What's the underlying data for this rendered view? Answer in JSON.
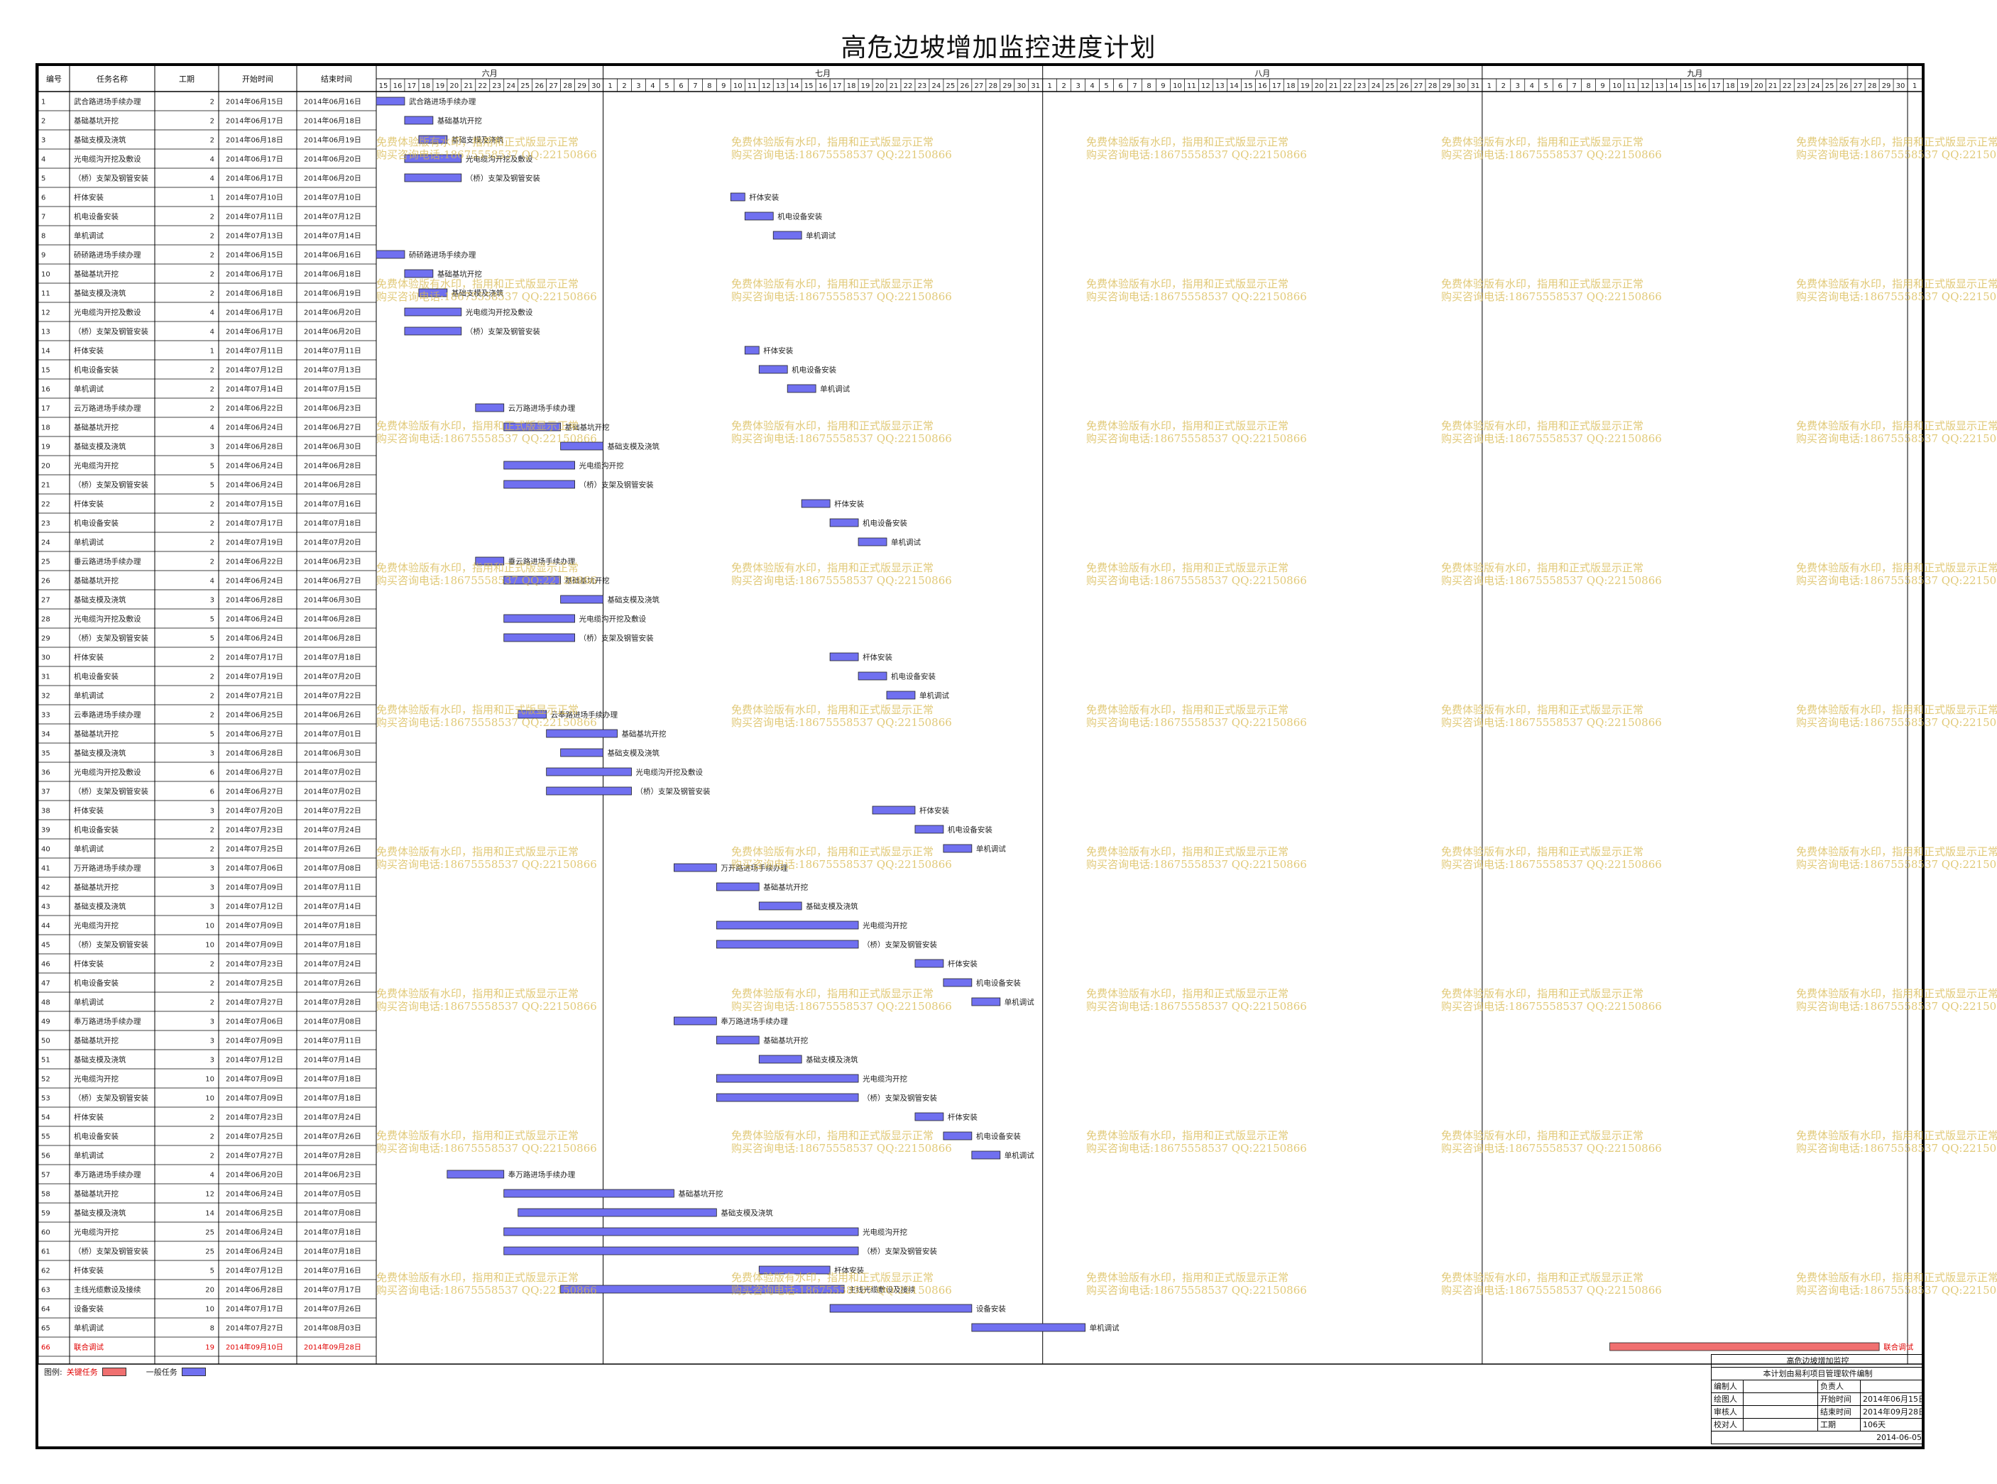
{
  "title": "高危边坡增加监控进度计划",
  "columns": {
    "id": "编号",
    "name": "任务名称",
    "duration": "工期",
    "start": "开始时间",
    "end": "结束时间"
  },
  "months": [
    "六月",
    "七月",
    "八月",
    "九月"
  ],
  "colors": {
    "normal_bar": "#7070f0",
    "critical_bar": "#f07070",
    "critical_text": "#e00000"
  },
  "chart_data": {
    "type": "gantt",
    "timeline_start": "2014-06-15",
    "timeline_end": "2014-10-01",
    "tasks": [
      {
        "id": "1",
        "name": "武合路进场手续办理",
        "duration": 2,
        "start": "2014年06月15日",
        "end": "2014年06月16日"
      },
      {
        "id": "2",
        "name": "基础基坑开挖",
        "duration": 2,
        "start": "2014年06月17日",
        "end": "2014年06月18日"
      },
      {
        "id": "3",
        "name": "基础支模及浇筑",
        "duration": 2,
        "start": "2014年06月18日",
        "end": "2014年06月19日"
      },
      {
        "id": "4",
        "name": "光电缆沟开挖及敷设",
        "duration": 4,
        "start": "2014年06月17日",
        "end": "2014年06月20日"
      },
      {
        "id": "5",
        "name": "（桥）支架及钢管安装",
        "duration": 4,
        "start": "2014年06月17日",
        "end": "2014年06月20日"
      },
      {
        "id": "6",
        "name": "杆体安装",
        "duration": 1,
        "start": "2014年07月10日",
        "end": "2014年07月10日"
      },
      {
        "id": "7",
        "name": "机电设备安装",
        "duration": 2,
        "start": "2014年07月11日",
        "end": "2014年07月12日"
      },
      {
        "id": "8",
        "name": "单机调试",
        "duration": 2,
        "start": "2014年07月13日",
        "end": "2014年07月14日"
      },
      {
        "id": "9",
        "name": "硚硚路进场手续办理",
        "duration": 2,
        "start": "2014年06月15日",
        "end": "2014年06月16日"
      },
      {
        "id": "10",
        "name": "基础基坑开挖",
        "duration": 2,
        "start": "2014年06月17日",
        "end": "2014年06月18日"
      },
      {
        "id": "11",
        "name": "基础支模及浇筑",
        "duration": 2,
        "start": "2014年06月18日",
        "end": "2014年06月19日"
      },
      {
        "id": "12",
        "name": "光电缆沟开挖及敷设",
        "duration": 4,
        "start": "2014年06月17日",
        "end": "2014年06月20日"
      },
      {
        "id": "13",
        "name": "（桥）支架及钢管安装",
        "duration": 4,
        "start": "2014年06月17日",
        "end": "2014年06月20日"
      },
      {
        "id": "14",
        "name": "杆体安装",
        "duration": 1,
        "start": "2014年07月11日",
        "end": "2014年07月11日"
      },
      {
        "id": "15",
        "name": "机电设备安装",
        "duration": 2,
        "start": "2014年07月12日",
        "end": "2014年07月13日"
      },
      {
        "id": "16",
        "name": "单机调试",
        "duration": 2,
        "start": "2014年07月14日",
        "end": "2014年07月15日"
      },
      {
        "id": "17",
        "name": "云万路进场手续办理",
        "duration": 2,
        "start": "2014年06月22日",
        "end": "2014年06月23日"
      },
      {
        "id": "18",
        "name": "基础基坑开挖",
        "duration": 4,
        "start": "2014年06月24日",
        "end": "2014年06月27日"
      },
      {
        "id": "19",
        "name": "基础支模及浇筑",
        "duration": 3,
        "start": "2014年06月28日",
        "end": "2014年06月30日"
      },
      {
        "id": "20",
        "name": "光电缆沟开挖",
        "duration": 5,
        "start": "2014年06月24日",
        "end": "2014年06月28日"
      },
      {
        "id": "21",
        "name": "（桥）支架及钢管安装",
        "duration": 5,
        "start": "2014年06月24日",
        "end": "2014年06月28日"
      },
      {
        "id": "22",
        "name": "杆体安装",
        "duration": 2,
        "start": "2014年07月15日",
        "end": "2014年07月16日"
      },
      {
        "id": "23",
        "name": "机电设备安装",
        "duration": 2,
        "start": "2014年07月17日",
        "end": "2014年07月18日"
      },
      {
        "id": "24",
        "name": "单机调试",
        "duration": 2,
        "start": "2014年07月19日",
        "end": "2014年07月20日"
      },
      {
        "id": "25",
        "name": "垂云路进场手续办理",
        "duration": 2,
        "start": "2014年06月22日",
        "end": "2014年06月23日"
      },
      {
        "id": "26",
        "name": "基础基坑开挖",
        "duration": 4,
        "start": "2014年06月24日",
        "end": "2014年06月27日"
      },
      {
        "id": "27",
        "name": "基础支模及浇筑",
        "duration": 3,
        "start": "2014年06月28日",
        "end": "2014年06月30日"
      },
      {
        "id": "28",
        "name": "光电缆沟开挖及敷设",
        "duration": 5,
        "start": "2014年06月24日",
        "end": "2014年06月28日"
      },
      {
        "id": "29",
        "name": "（桥）支架及钢管安装",
        "duration": 5,
        "start": "2014年06月24日",
        "end": "2014年06月28日"
      },
      {
        "id": "30",
        "name": "杆体安装",
        "duration": 2,
        "start": "2014年07月17日",
        "end": "2014年07月18日"
      },
      {
        "id": "31",
        "name": "机电设备安装",
        "duration": 2,
        "start": "2014年07月19日",
        "end": "2014年07月20日"
      },
      {
        "id": "32",
        "name": "单机调试",
        "duration": 2,
        "start": "2014年07月21日",
        "end": "2014年07月22日"
      },
      {
        "id": "33",
        "name": "云奉路进场手续办理",
        "duration": 2,
        "start": "2014年06月25日",
        "end": "2014年06月26日"
      },
      {
        "id": "34",
        "name": "基础基坑开挖",
        "duration": 5,
        "start": "2014年06月27日",
        "end": "2014年07月01日"
      },
      {
        "id": "35",
        "name": "基础支模及浇筑",
        "duration": 3,
        "start": "2014年06月28日",
        "end": "2014年06月30日"
      },
      {
        "id": "36",
        "name": "光电缆沟开挖及敷设",
        "duration": 6,
        "start": "2014年06月27日",
        "end": "2014年07月02日"
      },
      {
        "id": "37",
        "name": "（桥）支架及钢管安装",
        "duration": 6,
        "start": "2014年06月27日",
        "end": "2014年07月02日"
      },
      {
        "id": "38",
        "name": "杆体安装",
        "duration": 3,
        "start": "2014年07月20日",
        "end": "2014年07月22日"
      },
      {
        "id": "39",
        "name": "机电设备安装",
        "duration": 2,
        "start": "2014年07月23日",
        "end": "2014年07月24日"
      },
      {
        "id": "40",
        "name": "单机调试",
        "duration": 2,
        "start": "2014年07月25日",
        "end": "2014年07月26日"
      },
      {
        "id": "41",
        "name": "万开路进场手续办理",
        "duration": 3,
        "start": "2014年07月06日",
        "end": "2014年07月08日"
      },
      {
        "id": "42",
        "name": "基础基坑开挖",
        "duration": 3,
        "start": "2014年07月09日",
        "end": "2014年07月11日"
      },
      {
        "id": "43",
        "name": "基础支模及浇筑",
        "duration": 3,
        "start": "2014年07月12日",
        "end": "2014年07月14日"
      },
      {
        "id": "44",
        "name": "光电缆沟开挖",
        "duration": 10,
        "start": "2014年07月09日",
        "end": "2014年07月18日"
      },
      {
        "id": "45",
        "name": "（桥）支架及钢管安装",
        "duration": 10,
        "start": "2014年07月09日",
        "end": "2014年07月18日"
      },
      {
        "id": "46",
        "name": "杆体安装",
        "duration": 2,
        "start": "2014年07月23日",
        "end": "2014年07月24日"
      },
      {
        "id": "47",
        "name": "机电设备安装",
        "duration": 2,
        "start": "2014年07月25日",
        "end": "2014年07月26日"
      },
      {
        "id": "48",
        "name": "单机调试",
        "duration": 2,
        "start": "2014年07月27日",
        "end": "2014年07月28日"
      },
      {
        "id": "49",
        "name": "奉万路进场手续办理",
        "duration": 3,
        "start": "2014年07月06日",
        "end": "2014年07月08日"
      },
      {
        "id": "50",
        "name": "基础基坑开挖",
        "duration": 3,
        "start": "2014年07月09日",
        "end": "2014年07月11日"
      },
      {
        "id": "51",
        "name": "基础支模及浇筑",
        "duration": 3,
        "start": "2014年07月12日",
        "end": "2014年07月14日"
      },
      {
        "id": "52",
        "name": "光电缆沟开挖",
        "duration": 10,
        "start": "2014年07月09日",
        "end": "2014年07月18日"
      },
      {
        "id": "53",
        "name": "（桥）支架及钢管安装",
        "duration": 10,
        "start": "2014年07月09日",
        "end": "2014年07月18日"
      },
      {
        "id": "54",
        "name": "杆体安装",
        "duration": 2,
        "start": "2014年07月23日",
        "end": "2014年07月24日"
      },
      {
        "id": "55",
        "name": "机电设备安装",
        "duration": 2,
        "start": "2014年07月25日",
        "end": "2014年07月26日"
      },
      {
        "id": "56",
        "name": "单机调试",
        "duration": 2,
        "start": "2014年07月27日",
        "end": "2014年07月28日"
      },
      {
        "id": "57",
        "name": "奉万路进场手续办理",
        "duration": 4,
        "start": "2014年06月20日",
        "end": "2014年06月23日"
      },
      {
        "id": "58",
        "name": "基础基坑开挖",
        "duration": 12,
        "start": "2014年06月24日",
        "end": "2014年07月05日"
      },
      {
        "id": "59",
        "name": "基础支模及浇筑",
        "duration": 14,
        "start": "2014年06月25日",
        "end": "2014年07月08日"
      },
      {
        "id": "60",
        "name": "光电缆沟开挖",
        "duration": 25,
        "start": "2014年06月24日",
        "end": "2014年07月18日"
      },
      {
        "id": "61",
        "name": "（桥）支架及钢管安装",
        "duration": 25,
        "start": "2014年06月24日",
        "end": "2014年07月18日"
      },
      {
        "id": "62",
        "name": "杆体安装",
        "duration": 5,
        "start": "2014年07月12日",
        "end": "2014年07月16日"
      },
      {
        "id": "63",
        "name": "主线光缆敷设及接续",
        "duration": 20,
        "start": "2014年06月28日",
        "end": "2014年07月17日"
      },
      {
        "id": "64",
        "name": "设备安装",
        "duration": 10,
        "start": "2014年07月17日",
        "end": "2014年07月26日"
      },
      {
        "id": "65",
        "name": "单机调试",
        "duration": 8,
        "start": "2014年07月27日",
        "end": "2014年08月03日"
      },
      {
        "id": "66",
        "name": "联合调试",
        "duration": 19,
        "start": "2014年09月10日",
        "end": "2014年09月28日",
        "critical": true
      }
    ]
  },
  "watermark": {
    "line1": "免费体验版有水印，指用和正式版显示正常",
    "line2": "购买咨询电话:18675558537 QQ:22150866"
  },
  "legend": {
    "prefix": "图例:",
    "critical": "关键任务",
    "normal": "一般任务"
  },
  "info_box": {
    "title": "高危边坡增加监控",
    "subtitle": "本计划由易利项目管理软件编制",
    "rows": [
      {
        "k1": "编制人",
        "v1": "",
        "k2": "负责人",
        "v2": ""
      },
      {
        "k1": "绘图人",
        "v1": "",
        "k2": "开始时间",
        "v2": "2014年06月15日"
      },
      {
        "k1": "审核人",
        "v1": "",
        "k2": "结束时间",
        "v2": "2014年09月28日"
      },
      {
        "k1": "校对人",
        "v1": "",
        "k2": "工期",
        "v2": "106天"
      }
    ],
    "date": "2014-06-05"
  }
}
